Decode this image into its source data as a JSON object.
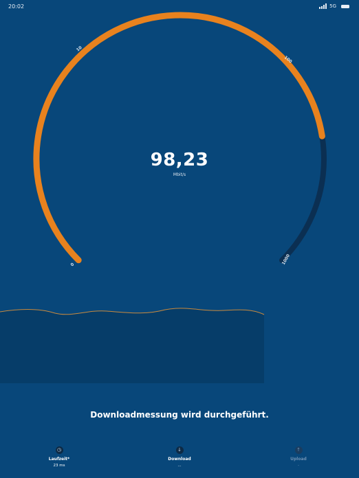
{
  "status_bar": {
    "time": "20:02",
    "network": "5G"
  },
  "gauge": {
    "value": "98,23",
    "unit": "Mbit/s",
    "scale": [
      {
        "label": "0",
        "position": "start"
      },
      {
        "label": "10",
        "position": "left-top"
      },
      {
        "label": "100",
        "position": "right-top"
      },
      {
        "label": "1000",
        "position": "end"
      }
    ],
    "filled_fraction": 0.8,
    "colors": {
      "active": "#e8821e",
      "track": "#0b2f52",
      "background": "#08477a"
    }
  },
  "message": "Downloadmessung wird durchgeführt.",
  "tabs": [
    {
      "label": "Laufzeit*",
      "value": "23 ms",
      "icon": "clock-icon",
      "state": "done"
    },
    {
      "label": "Download",
      "value": "...",
      "icon": "download-icon",
      "state": "active"
    },
    {
      "label": "Upload",
      "value": "-",
      "icon": "upload-icon",
      "state": "pending"
    }
  ]
}
